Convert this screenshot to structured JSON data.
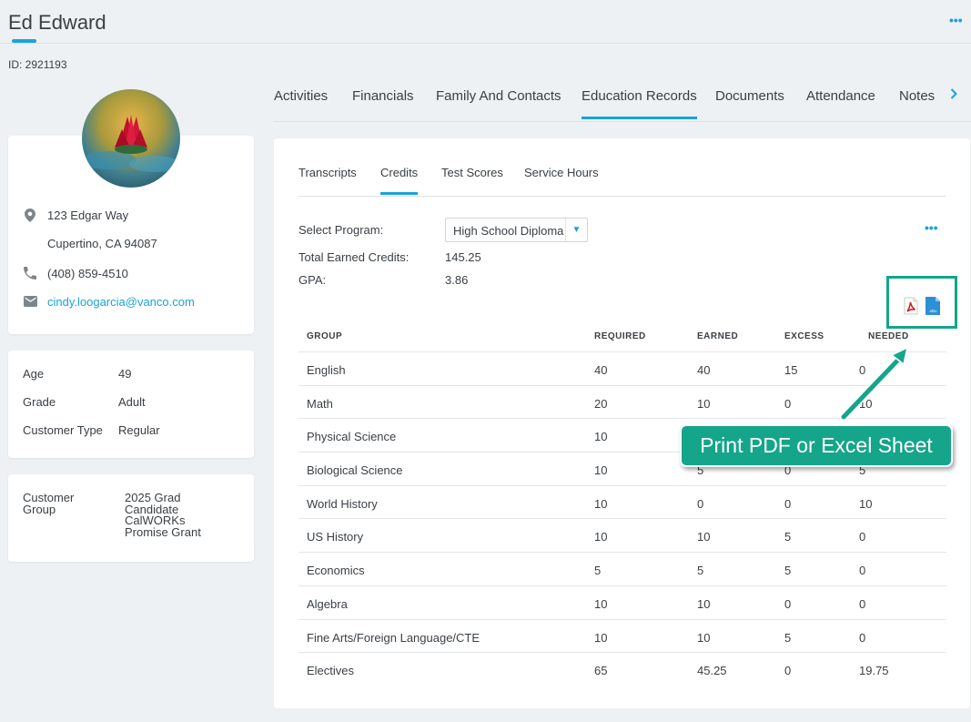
{
  "profile": {
    "name": "Ed Edward",
    "id_line": "ID: 2921193",
    "address_line1": "123 Edgar Way",
    "address_line2": "Cupertino, CA 94087",
    "phone": "(408) 859-4510",
    "email": "cindy.loogarcia@vanco.com",
    "age_label": "Age",
    "age": "49",
    "grade_label": "Grade",
    "grade": "Adult",
    "customer_type_label": "Customer Type",
    "customer_type": "Regular",
    "customer_group_label_1": "Customer",
    "customer_group_label_2": "Group",
    "customer_groups": [
      "2025 Grad",
      "Candidate",
      "CalWORKs",
      "Promise Grant"
    ]
  },
  "main_tabs": [
    "Activities",
    "Financials",
    "Family And Contacts",
    "Education Records",
    "Documents",
    "Attendance",
    "Notes"
  ],
  "main_tab_active": "Education Records",
  "sub_tabs": [
    "Transcripts",
    "Credits",
    "Test Scores",
    "Service Hours"
  ],
  "sub_tab_active": "Credits",
  "credits": {
    "select_program_label": "Select Program:",
    "program": "High School Diploma",
    "total_credits_label": "Total Earned Credits:",
    "total_credits": "145.25",
    "gpa_label": "GPA:",
    "gpa": "3.86",
    "pdf_icon": "pdf-file-icon",
    "excel_icon": "xlsx-file-icon",
    "columns": [
      "GROUP",
      "REQUIRED",
      "EARNED",
      "EXCESS",
      "NEEDED"
    ],
    "rows": [
      [
        "English",
        "40",
        "40",
        "15",
        "0"
      ],
      [
        "Math",
        "20",
        "10",
        "0",
        "10"
      ],
      [
        "Physical Science",
        "10",
        "",
        "",
        ""
      ],
      [
        "Biological Science",
        "10",
        "5",
        "0",
        "5"
      ],
      [
        "World History",
        "10",
        "0",
        "0",
        "10"
      ],
      [
        "US History",
        "10",
        "10",
        "5",
        "0"
      ],
      [
        "Economics",
        "5",
        "5",
        "5",
        "0"
      ],
      [
        "Algebra",
        "10",
        "10",
        "0",
        "0"
      ],
      [
        "Fine Arts/Foreign Language/CTE",
        "10",
        "10",
        "5",
        "0"
      ],
      [
        "Electives",
        "65",
        "45.25",
        "0",
        "19.75"
      ]
    ]
  },
  "callout": {
    "text": "Print PDF or Excel Sheet"
  },
  "colors": {
    "accent": "#1aa3d9",
    "callout": "#14a58a",
    "background": "#edf1f4"
  }
}
